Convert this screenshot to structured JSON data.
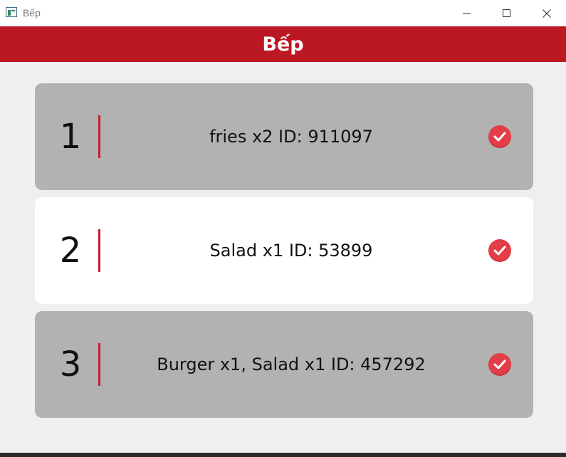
{
  "window": {
    "title": "Bếp",
    "app_icon": "app-icon",
    "controls": [
      "minimize-icon",
      "maximize-icon",
      "close-icon"
    ]
  },
  "header": {
    "title": "Bếp",
    "background": "#bc1823"
  },
  "colors": {
    "card_default": "#b2b2b2",
    "card_selected": "#ffffff",
    "divider": "#c0202a",
    "check": "#e33d48"
  },
  "orders": [
    {
      "number": "1",
      "text": "fries x2 ID: 911097",
      "selected": false,
      "action_icon": "check-circle-icon"
    },
    {
      "number": "2",
      "text": "Salad x1 ID: 53899",
      "selected": true,
      "action_icon": "check-circle-icon"
    },
    {
      "number": "3",
      "text": "Burger x1, Salad x1 ID: 457292",
      "selected": false,
      "action_icon": "check-circle-icon"
    }
  ]
}
